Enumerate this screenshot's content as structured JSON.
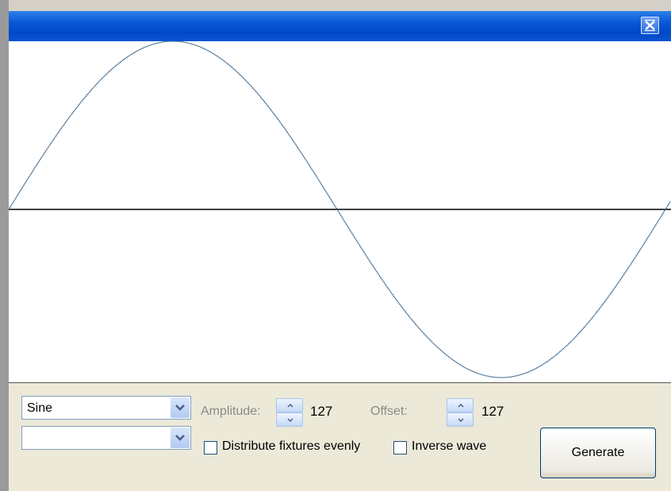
{
  "window": {
    "close_icon": "close-icon"
  },
  "wave_display": {
    "waveform": "sine",
    "line_color": "#1f4e79",
    "axis_color": "#000000"
  },
  "controls": {
    "wave_type": {
      "value": "Sine"
    },
    "secondary_select": {
      "value": ""
    },
    "amplitude": {
      "label": "Amplitude:",
      "value": "127"
    },
    "offset": {
      "label": "Offset:",
      "value": "127"
    },
    "distribute": {
      "label": "Distribute fixtures evenly",
      "checked": false
    },
    "inverse": {
      "label": "Inverse wave",
      "checked": false
    },
    "generate_label": "Generate"
  },
  "colors": {
    "titlebar": "#0a5ad8",
    "panel": "#ece9d8"
  }
}
